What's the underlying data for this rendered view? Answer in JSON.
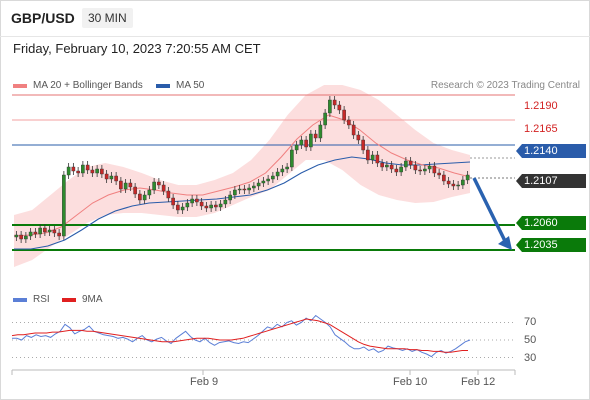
{
  "header": {
    "symbol": "GBP/USD",
    "timeframe": "30 MIN"
  },
  "datetime": "Friday, February 10, 2023 7:20:55 AM CET",
  "legend": {
    "bb_label": "MA 20 + Bollinger Bands",
    "bb_color": "#f08080",
    "ma50_label": "MA 50",
    "ma50_color": "#2a5caa"
  },
  "research": "Research © 2023 Trading Central",
  "rsi_legend": {
    "rsi_label": "RSI",
    "rsi_color": "#5b7fd6",
    "ma_label": "9MA",
    "ma_color": "#e02020"
  },
  "levels": {
    "r2": "1.2190",
    "r1": "1.2165",
    "pivot": "1.2140",
    "last": "1.2107",
    "s1": "1.2060",
    "s2": "1.2035"
  },
  "rsi_ticks": [
    "70",
    "50",
    "30"
  ],
  "x_labels": [
    "Feb 9",
    "Feb 10",
    "Feb 12"
  ],
  "colors": {
    "up": "#2e8b2e",
    "down": "#c62828",
    "pivot_line": "#2a5caa",
    "support": "#0a7a0a",
    "last_tag": "#333333",
    "arrow": "#2a62b0",
    "band": "#fbd3d3"
  },
  "chart_data": {
    "type": "candlestick",
    "y_range": [
      1.2005,
      1.2205
    ],
    "price": [
      1.205,
      1.2046,
      1.2049,
      1.2053,
      1.2051,
      1.2057,
      1.2053,
      1.2055,
      1.2052,
      1.2049,
      1.211,
      1.2118,
      1.2114,
      1.2112,
      1.212,
      1.2115,
      1.2112,
      1.2116,
      1.2111,
      1.2106,
      1.2109,
      1.2104,
      1.2096,
      1.2102,
      1.2098,
      1.2091,
      1.2085,
      1.209,
      1.2095,
      1.2103,
      1.21,
      1.2094,
      1.2087,
      1.208,
      1.2075,
      1.2078,
      1.2082,
      1.2086,
      1.2083,
      1.2079,
      1.2077,
      1.208,
      1.2078,
      1.2081,
      1.2085,
      1.209,
      1.2095,
      1.2096,
      1.2095,
      1.2097,
      1.2099,
      1.2102,
      1.2104,
      1.2106,
      1.2109,
      1.2113,
      1.2116,
      1.2118,
      1.2135,
      1.214,
      1.2145,
      1.2138,
      1.2151,
      1.2147,
      1.216,
      1.2172,
      1.2185,
      1.218,
      1.2175,
      1.2165,
      1.216,
      1.215,
      1.2145,
      1.2135,
      1.2125,
      1.213,
      1.2122,
      1.2118,
      1.212,
      1.2116,
      1.2113,
      1.2118,
      1.2124,
      1.212,
      1.2115,
      1.2114,
      1.2116,
      1.2119,
      1.2112,
      1.211,
      1.2104,
      1.2101,
      1.2099,
      1.21,
      1.2105,
      1.211
    ],
    "ma20": [
      1.2049,
      1.205,
      1.2052,
      1.2058,
      1.207,
      1.2082,
      1.209,
      1.2095,
      1.2097,
      1.2095,
      1.2092,
      1.209,
      1.209,
      1.2094,
      1.2098,
      1.2103,
      1.2112,
      1.2128,
      1.2146,
      1.216,
      1.217,
      1.2165,
      1.2155,
      1.2142,
      1.2132,
      1.2125,
      1.212,
      1.2117,
      1.2112,
      1.2108
    ],
    "ma50": [
      1.2036,
      1.2036,
      1.2039,
      1.2045,
      1.2055,
      1.2066,
      1.2074,
      1.2079,
      1.2082,
      1.2083,
      1.2084,
      1.2085,
      1.2086,
      1.2088,
      1.209,
      1.2095,
      1.2102,
      1.2112,
      1.212,
      1.2125,
      1.2128,
      1.2126,
      1.2122,
      1.212,
      1.212,
      1.2121,
      1.2122,
      1.2123
    ],
    "bb_upper": [
      1.207,
      1.2075,
      1.209,
      1.2105,
      1.2118,
      1.2122,
      1.2118,
      1.2112,
      1.2105,
      1.21,
      1.21,
      1.2105,
      1.2112,
      1.2125,
      1.2145,
      1.217,
      1.219,
      1.22,
      1.22,
      1.2195,
      1.2185,
      1.217,
      1.2155,
      1.2142,
      1.2135,
      1.213
    ],
    "bb_lower": [
      1.2018,
      1.2025,
      1.2038,
      1.205,
      1.2062,
      1.207,
      1.2072,
      1.2072,
      1.207,
      1.2068,
      1.2068,
      1.2072,
      1.208,
      1.2088,
      1.2095,
      1.211,
      1.2125,
      1.2125,
      1.2115,
      1.21,
      1.209,
      1.2085,
      1.2082,
      1.2083,
      1.2088,
      1.2092
    ],
    "levels": [
      1.219,
      1.2165,
      1.214,
      1.2107,
      1.206,
      1.2035
    ],
    "forecast": [
      1.2107,
      1.2035
    ],
    "rsi": {
      "range": [
        10,
        90
      ],
      "ticks": [
        70,
        50,
        30
      ],
      "rsi": [
        52,
        52,
        50,
        55,
        53,
        56,
        54,
        55,
        53,
        57,
        60,
        68,
        64,
        57,
        60,
        62,
        66,
        60,
        58,
        56,
        55,
        54,
        52,
        53,
        51,
        48,
        52,
        55,
        50,
        48,
        51,
        53,
        49,
        46,
        52,
        56,
        60,
        54,
        50,
        48,
        52,
        47,
        44,
        47,
        48,
        49,
        47,
        46,
        48,
        47,
        51,
        55,
        60,
        65,
        63,
        68,
        65,
        70,
        72,
        67,
        70,
        75,
        72,
        78,
        74,
        70,
        65,
        56,
        52,
        48,
        43,
        40,
        40,
        42,
        38,
        40,
        36,
        38,
        43,
        41,
        40,
        38,
        40,
        37,
        39,
        36,
        34,
        31,
        36,
        38,
        35,
        37,
        40,
        44,
        48,
        50
      ],
      "ma9": [
        55,
        56,
        56,
        57,
        58,
        58,
        58,
        59,
        59,
        60,
        61,
        61,
        61,
        60,
        60,
        59,
        58,
        57,
        56,
        55,
        54,
        53,
        52,
        51,
        50,
        49,
        48,
        48,
        48,
        49,
        50,
        51,
        52,
        52,
        52,
        51,
        50,
        50,
        50,
        51,
        52,
        54,
        56,
        58,
        60,
        62,
        64,
        66,
        68,
        70,
        72,
        74,
        73,
        72,
        70,
        68,
        64,
        60,
        56,
        52,
        48,
        45,
        43,
        42,
        41,
        40,
        40,
        40,
        40,
        39,
        39,
        38,
        38,
        37,
        37,
        36,
        36,
        37,
        38,
        38
      ]
    },
    "x_ticks": [
      "Feb 9",
      "Feb 10",
      "Feb 12"
    ]
  }
}
